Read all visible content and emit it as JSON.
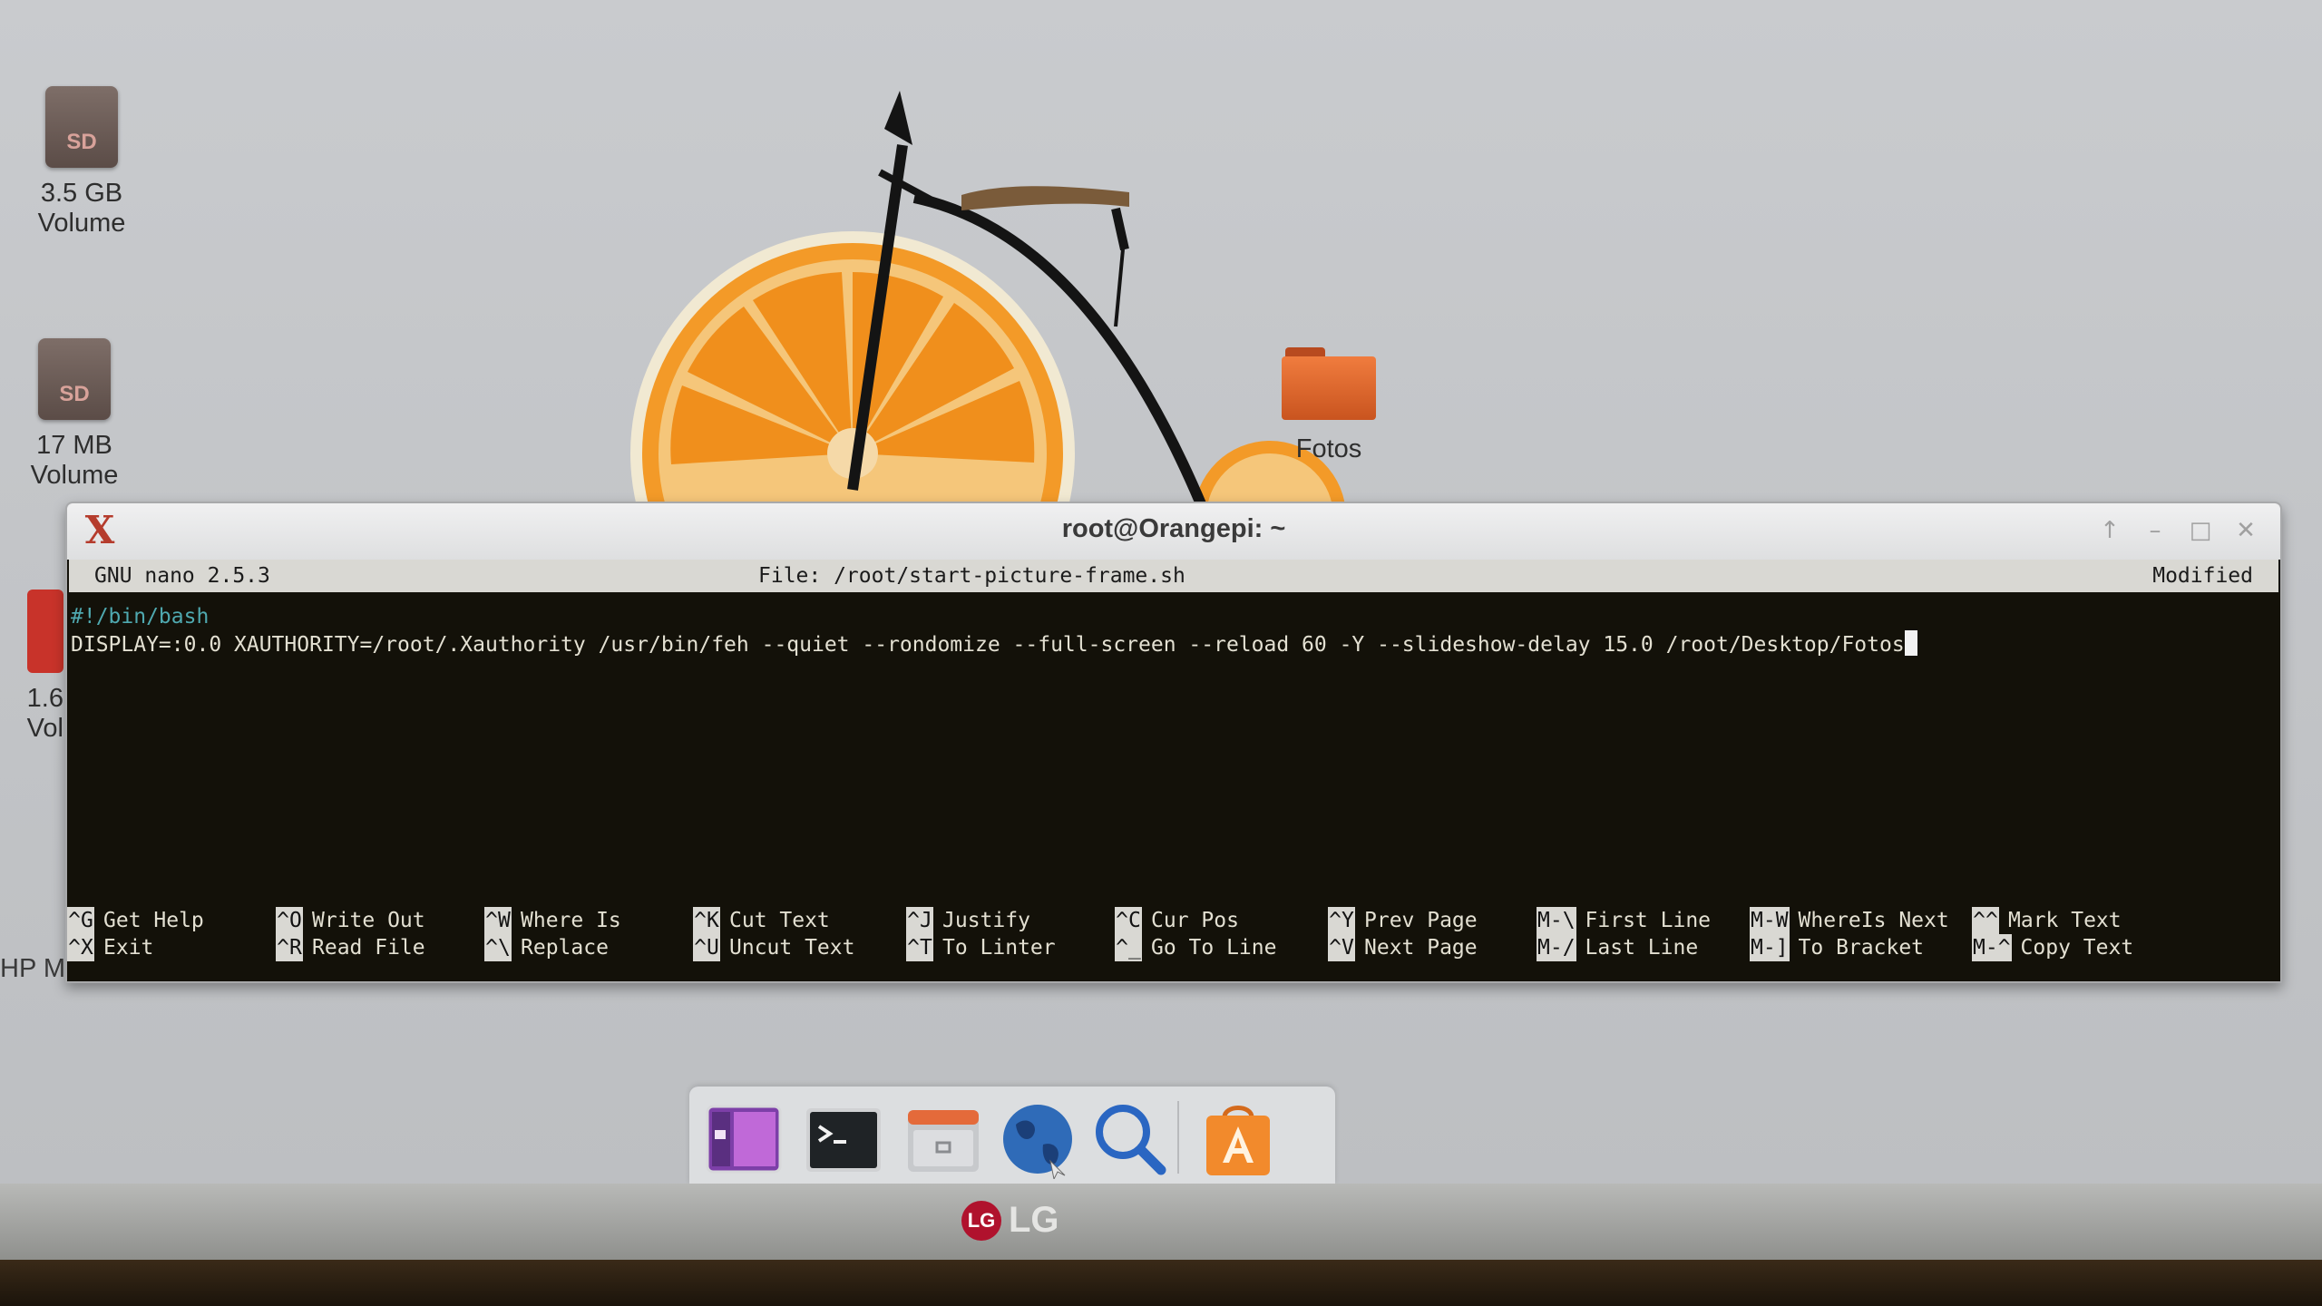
{
  "desktop": {
    "icons": [
      {
        "label": "3.5 GB Volume",
        "badge": "SD"
      },
      {
        "label": "17 MB Volume",
        "badge": "SD"
      },
      {
        "label": "1.6 Vol"
      },
      {
        "label": "HP MAKI"
      },
      {
        "label": "Fotos"
      }
    ]
  },
  "window": {
    "title": "root@Orangepi: ~",
    "controls": [
      "up-arrow-icon",
      "minimize-icon",
      "maximize-icon",
      "close-icon"
    ]
  },
  "nano": {
    "version": "GNU nano 2.5.3",
    "file": "File: /root/start-picture-frame.sh",
    "status": "Modified",
    "lines": [
      "#!/bin/bash",
      "DISPLAY=:0.0 XAUTHORITY=/root/.Xauthority /usr/bin/feh --quiet --rondomize --full-screen --reload 60 -Y --slideshow-delay 15.0 /root/Desktop/Fotos"
    ],
    "shortcuts": [
      {
        "k1": "^G",
        "l1": "Get Help",
        "k2": "^X",
        "l2": "Exit"
      },
      {
        "k1": "^O",
        "l1": "Write Out",
        "k2": "^R",
        "l2": "Read File"
      },
      {
        "k1": "^W",
        "l1": "Where Is",
        "k2": "^\\",
        "l2": "Replace"
      },
      {
        "k1": "^K",
        "l1": "Cut Text",
        "k2": "^U",
        "l2": "Uncut Text"
      },
      {
        "k1": "^J",
        "l1": "Justify",
        "k2": "^T",
        "l2": "To Linter"
      },
      {
        "k1": "^C",
        "l1": "Cur Pos",
        "k2": "^_",
        "l2": "Go To Line"
      },
      {
        "k1": "^Y",
        "l1": "Prev Page",
        "k2": "^V",
        "l2": "Next Page"
      },
      {
        "k1": "M-\\",
        "l1": "First Line",
        "k2": "M-/",
        "l2": "Last Line"
      },
      {
        "k1": "M-W",
        "l1": "WhereIs Next",
        "k2": "M-]",
        "l2": "To Bracket"
      },
      {
        "k1": "^^",
        "l1": "Mark Text",
        "k2": "M-^",
        "l2": "Copy Text"
      }
    ]
  },
  "dock": {
    "items": [
      "workspace-switcher-icon",
      "terminal-icon",
      "file-manager-icon",
      "web-browser-icon",
      "search-icon",
      "app-store-icon"
    ]
  },
  "monitor": {
    "brand": "LG",
    "logo_mark": "LG"
  },
  "colors": {
    "terminal_bg": "#131109",
    "shebang": "#4fa9b0",
    "dock_store": "#f28a2c"
  }
}
